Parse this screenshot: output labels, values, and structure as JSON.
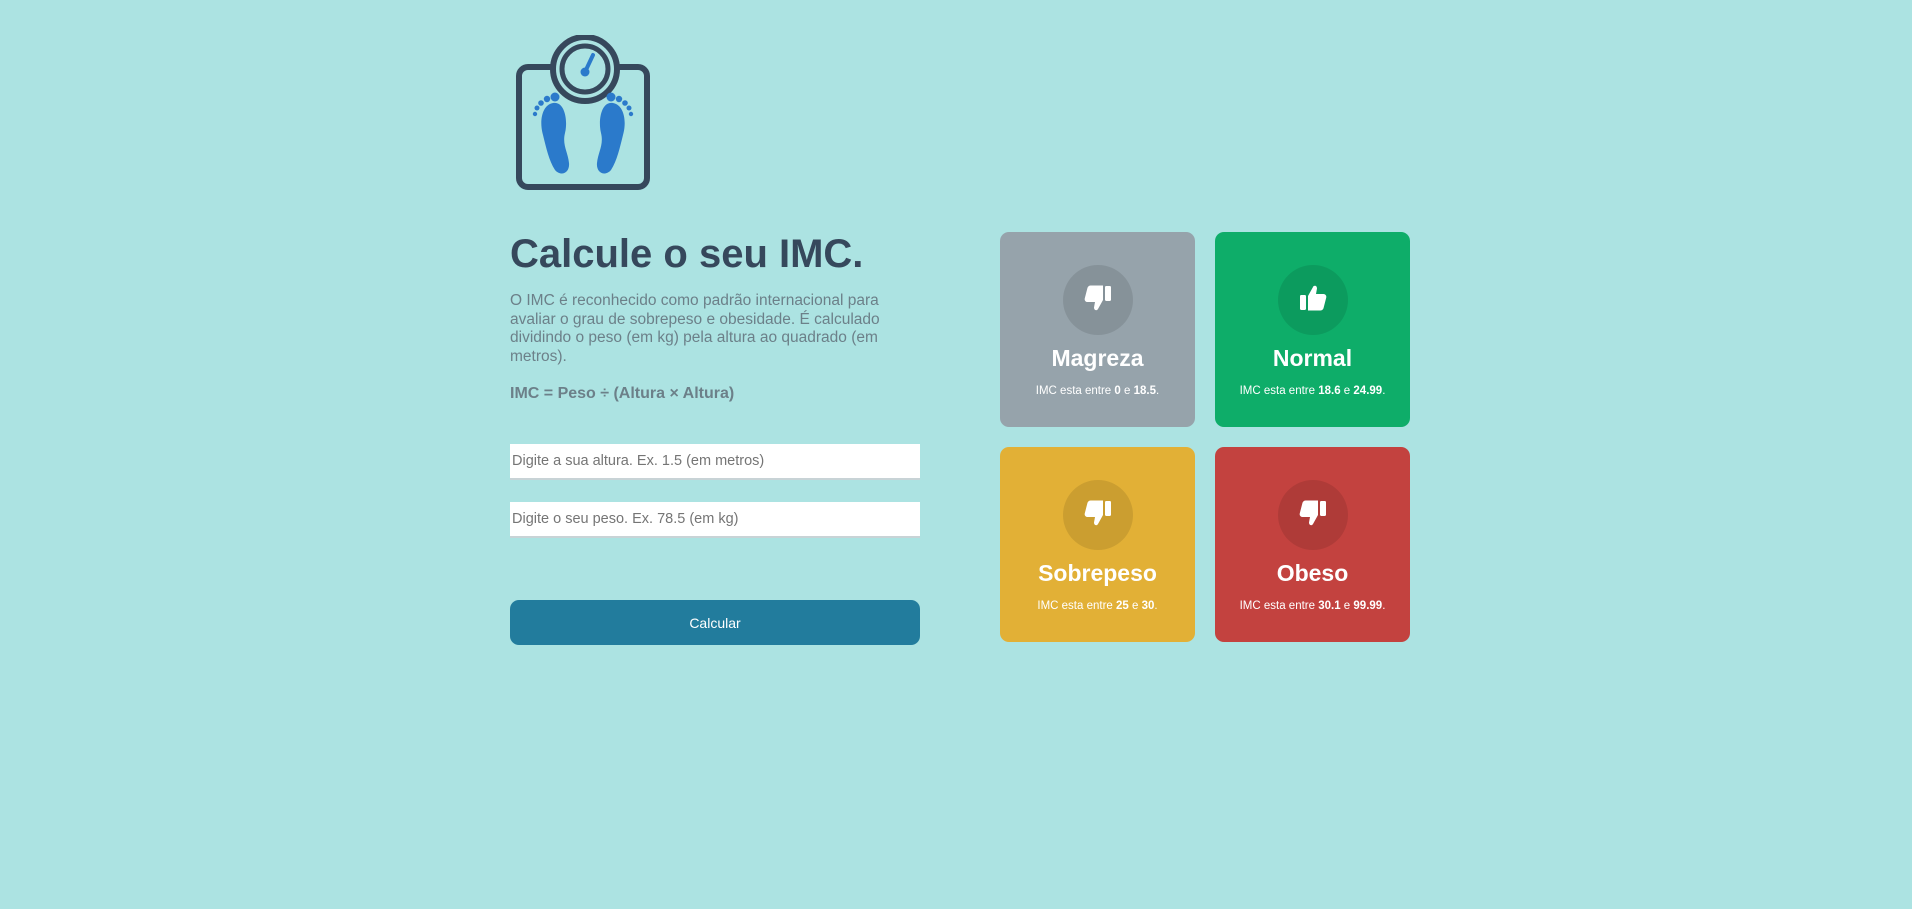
{
  "colors": {
    "background": "#ace3e2",
    "title": "#36485c",
    "text": "#6c8089",
    "button": "#227c9d",
    "logo_dark": "#36485c",
    "logo_blue": "#2b7acb"
  },
  "logo": {
    "icon": "scale-feet-icon"
  },
  "header": {
    "title": "Calcule o seu IMC.",
    "description": "O IMC é reconhecido como padrão internacional para avaliar o grau de sobrepeso e obesidade. É calculado dividindo o peso (em kg) pela altura ao quadrado (em metros).",
    "formula": "IMC = Peso ÷ (Altura × Altura)"
  },
  "form": {
    "height_placeholder": "Digite a sua altura. Ex. 1.5 (em metros)",
    "height_value": "",
    "weight_placeholder": "Digite o seu peso. Ex. 78.5 (em kg)",
    "weight_value": "",
    "button_label": "Calcular"
  },
  "cards": [
    {
      "title": "Magreza",
      "color": "#96a3ab",
      "icon": "thumbs-down-icon",
      "info_prefix": "IMC esta entre ",
      "min": "0",
      "connector": " e ",
      "max": "18.5",
      "suffix": "."
    },
    {
      "title": "Normal",
      "color": "#0ead69",
      "icon": "thumbs-up-icon",
      "info_prefix": "IMC esta entre ",
      "min": "18.6",
      "connector": " e ",
      "max": "24.99",
      "suffix": "."
    },
    {
      "title": "Sobrepeso",
      "color": "#e2b036",
      "icon": "thumbs-down-icon",
      "info_prefix": "IMC esta entre ",
      "min": "25",
      "connector": " e ",
      "max": "30",
      "suffix": "."
    },
    {
      "title": "Obeso",
      "color": "#c3423f",
      "icon": "thumbs-down-icon",
      "info_prefix": "IMC esta entre ",
      "min": "30.1",
      "connector": " e ",
      "max": "99.99",
      "suffix": "."
    }
  ]
}
